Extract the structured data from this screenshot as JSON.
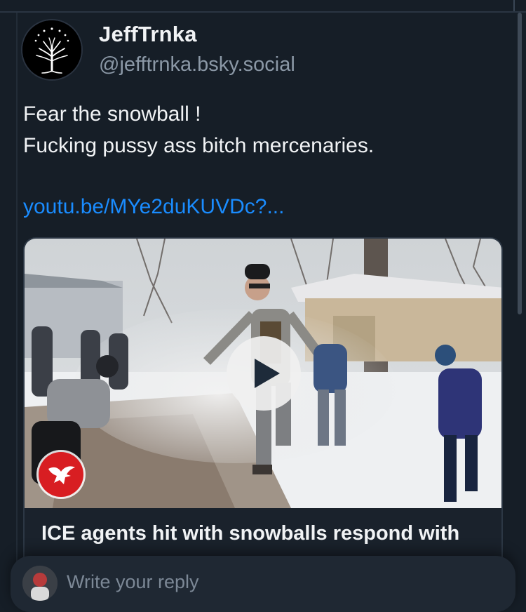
{
  "post": {
    "author": {
      "display_name": "JeffTrnka",
      "handle": "@jefftrnka.bsky.social",
      "avatar_icon": "white-tree-icon"
    },
    "text_lines": [
      "Fear the snowball !",
      "Fucking pussy ass bitch mercenaries."
    ],
    "link": "youtu.be/MYe2duKUVDc?..."
  },
  "embed": {
    "title": "ICE agents hit with snowballs respond with",
    "play_icon": "play-icon",
    "source_icon": "eagle-logo-icon"
  },
  "reply_composer": {
    "placeholder": "Write your reply"
  },
  "colors": {
    "background": "#161e27",
    "link": "#1a8cff",
    "muted_text": "#8b98a6",
    "card_border": "#2c3744"
  }
}
